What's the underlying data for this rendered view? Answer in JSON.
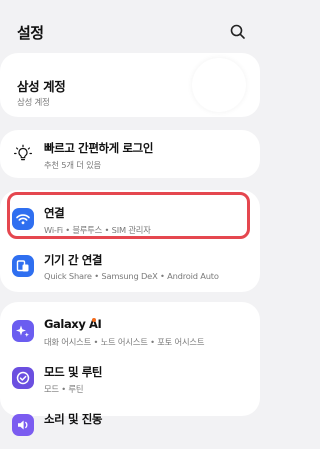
{
  "header": {
    "title": "설정"
  },
  "account": {
    "name": "삼성 계정",
    "subtitle": "삼성 계정"
  },
  "quick_login": {
    "title": "빠르고 간편하게 로그인",
    "subtitle": "추천 5개 더 있음"
  },
  "group1": [
    {
      "title": "연결",
      "subtitle": "Wi-Fi • 블루투스 • SIM 관리자"
    },
    {
      "title": "기기 간 연결",
      "subtitle": "Quick Share • Samsung DeX • Android Auto"
    }
  ],
  "group2": [
    {
      "title": "Galaxy AI",
      "subtitle": "대화 어시스트 • 노트 어시스트 • 포토 어시스트"
    },
    {
      "title": "모드 및 루틴",
      "subtitle": "모드 • 루틴"
    },
    {
      "title": "소리 및 진동",
      "subtitle": ""
    }
  ],
  "colors": {
    "accent_blue": "#2f6ff0",
    "highlight_red": "#e5474f",
    "ai_purple": "#6b5df0",
    "routine_purple": "#6b4fe0",
    "sound_purple": "#7b5cf0",
    "notification_dot": "#f36b1b"
  },
  "icons": {
    "search": "search-icon",
    "quick_login": "lightbulb-icon",
    "connections": "wifi-icon",
    "connected_devices": "devices-icon",
    "galaxy_ai": "sparkle-icon",
    "modes": "check-circle-icon",
    "sound": "speaker-icon"
  }
}
